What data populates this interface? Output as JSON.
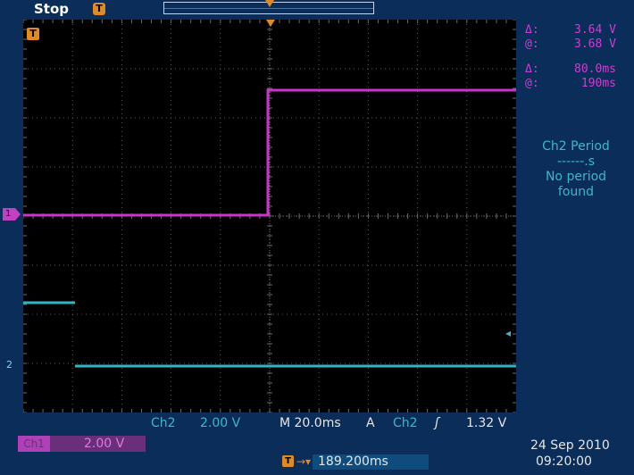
{
  "status": {
    "run_state": "Stop"
  },
  "icons": {
    "trigger_position": "trigger-position-icon",
    "trigger": "trigger-t-icon"
  },
  "markers": {
    "ch1": "1",
    "ch2": "2"
  },
  "cursors": {
    "delta_symbol": "Δ:",
    "at_symbol": "@:",
    "delta_v": "3.64 V",
    "at_v": "3.68 V",
    "delta_t": "80.0ms",
    "at_t": "190ms"
  },
  "measurement": {
    "line1": "Ch2 Period",
    "line2": "------.s",
    "line3": "No period",
    "line4": "found"
  },
  "bottom": {
    "ch2_label": "Ch2",
    "ch2_scale": "2.00 V",
    "timebase": "M 20.0ms",
    "trigger_mode": "A",
    "trigger_source": "Ch2",
    "trigger_slope": "ʃ",
    "trigger_level": "1.32 V",
    "ch1_tag": "Ch1",
    "ch1_scale": "2.00 V",
    "horizontal_position": "189.200ms",
    "date": "24 Sep 2010",
    "time": "09:20:00"
  },
  "colors": {
    "ch1": "#cc33cc",
    "ch2": "#33b4c6",
    "trigger": "#e08a22",
    "background": "#0b2d5a"
  }
}
